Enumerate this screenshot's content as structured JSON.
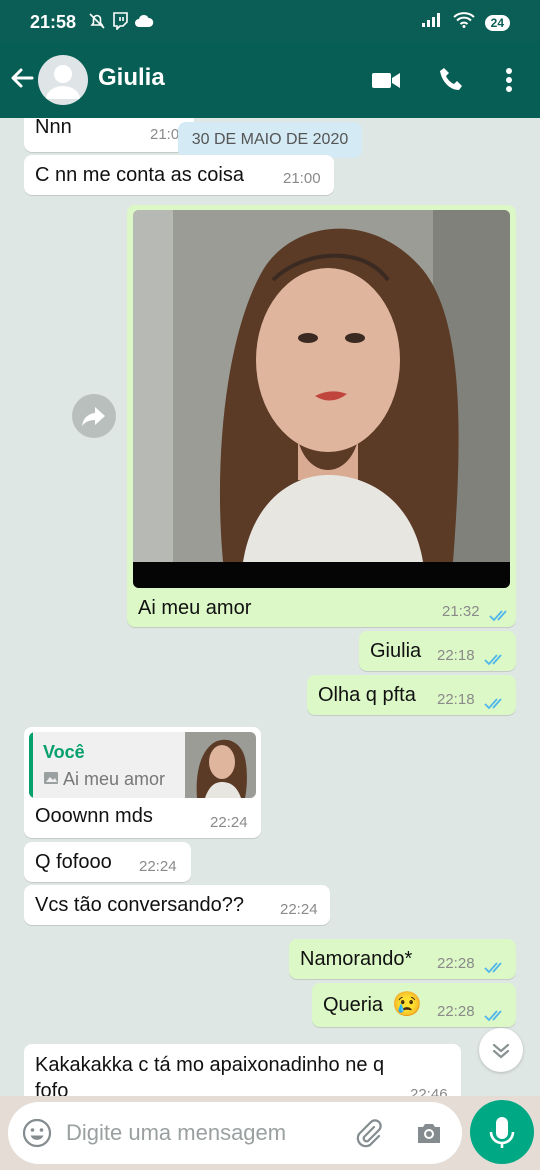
{
  "status_bar": {
    "time": "21:58",
    "battery": "24"
  },
  "header": {
    "contact_name": "Giulia"
  },
  "chat": {
    "date_chip": "30 DE MAIO DE 2020",
    "messages": [
      {
        "text": "Nnn",
        "time": "21:0"
      },
      {
        "text": "C nn me conta as coisa",
        "time": "21:00"
      },
      {
        "text": "Ai meu amor",
        "time": "21:32"
      },
      {
        "text": "Giulia",
        "time": "22:18"
      },
      {
        "text": "Olha q pfta",
        "time": "22:18"
      },
      {
        "reply_author": "Você",
        "reply_text": "Ai meu amor",
        "text": "Ooownn mds",
        "time": "22:24"
      },
      {
        "text": "Q fofooo",
        "time": "22:24"
      },
      {
        "text": "Vcs tão conversando??",
        "time": "22:24"
      },
      {
        "text": "Namorando*",
        "time": "22:28"
      },
      {
        "text": "Queria",
        "emoji": "😢",
        "time": "22:28"
      },
      {
        "text": "Kakakakka c tá mo apaixonadinho ne q",
        "text2": "fofo",
        "time": "22:46"
      }
    ]
  },
  "input": {
    "placeholder": "Digite uma mensagem"
  },
  "colors": {
    "header": "#075e54",
    "outgoing": "#dcf8c6",
    "incoming": "#ffffff",
    "read_ticks": "#4fb6ec",
    "fab": "#00a884"
  }
}
